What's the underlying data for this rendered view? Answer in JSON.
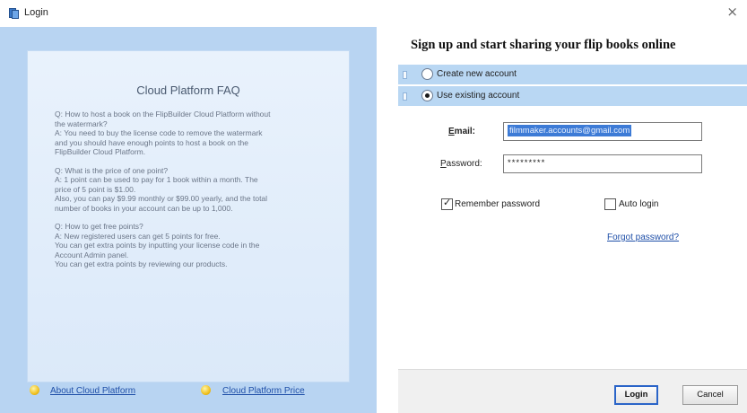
{
  "window": {
    "title": "Login",
    "close_glyph": "×"
  },
  "faq": {
    "title": "Cloud Platform FAQ",
    "items": [
      {
        "lines": [
          "Q: How to host a book on the FlipBuilder Cloud Platform without",
          "the watermark?",
          "A: You need to buy the license code to remove the watermark",
          "and you should have enough points to host a book on the",
          "FlipBuilder Cloud Platform."
        ]
      },
      {
        "lines": [
          "Q: What is the price of one point?",
          "A: 1 point can be used to pay for 1 book within a month. The",
          "price of 5 point is $1.00.",
          "Also, you can pay $9.99 monthly or $99.00 yearly, and the total",
          "number of books in your account can be up to 1,000."
        ]
      },
      {
        "lines": [
          "Q: How to get free points?",
          "A: New registered users can get 5 points for free.",
          "You can get extra points by inputting your license code in the",
          "Account Admin panel.",
          "You can get extra points by reviewing our products."
        ]
      }
    ],
    "footer_links": {
      "about": "About Cloud Platform",
      "price": "Cloud Platform Price"
    }
  },
  "signup": {
    "header": "Sign up and start sharing your flip books online",
    "options": {
      "create": "Create new account",
      "use_existing": "Use existing account",
      "selected": "use_existing"
    },
    "email": {
      "label_underlined": "E",
      "label_rest": "mail:",
      "value": "filmmaker.accounts@gmail.com"
    },
    "password": {
      "label_underlined": "P",
      "label_rest": "assword:",
      "value": "*********"
    },
    "remember_password": {
      "label": "Remember password",
      "checked": true
    },
    "auto_login": {
      "label": "Auto login",
      "checked": false
    },
    "forgot_password": "Forgot password?"
  },
  "buttons": {
    "login": "Login",
    "cancel": "Cancel"
  },
  "colors": {
    "panel_blue": "#b8d4f2",
    "selected_row": "#b9d7f3",
    "link": "#1f4fa8",
    "login_border": "#2a64c8"
  },
  "icons": {
    "app": "flipbook-app-icon",
    "close": "close-icon",
    "footer_bullets": "lightbulb-icon"
  }
}
